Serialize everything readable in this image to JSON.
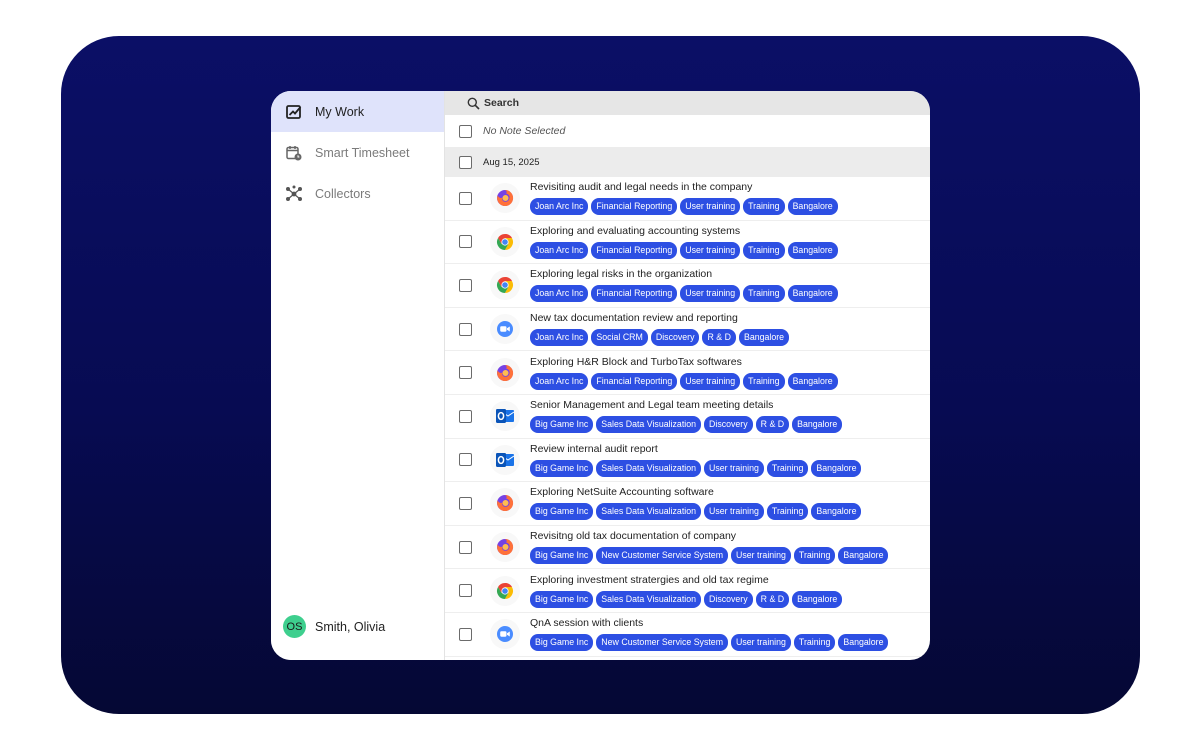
{
  "sidebar": {
    "items": [
      {
        "label": "My Work",
        "icon": "my-work-icon",
        "active": true
      },
      {
        "label": "Smart Timesheet",
        "icon": "timesheet-icon",
        "active": false
      },
      {
        "label": "Collectors",
        "icon": "collectors-icon",
        "active": false
      }
    ],
    "user": {
      "initials": "OS",
      "name": "Smith, Olivia"
    }
  },
  "search": {
    "label": "Search"
  },
  "selection": {
    "label": "No Note Selected"
  },
  "date_group": {
    "label": "Aug 15, 2025"
  },
  "colors": {
    "tag": "#2d4fe3",
    "avatar": "#3ecf8e",
    "backdrop": "#0b0f66",
    "active_nav": "#dfe3fb"
  },
  "notes": [
    {
      "title": "Revisiting audit and legal needs in the company",
      "app": "firefox-icon",
      "tags": [
        "Joan Arc Inc",
        "Financial Reporting",
        "User training",
        "Training",
        "Bangalore"
      ]
    },
    {
      "title": "Exploring and evaluating accounting systems",
      "app": "chrome-icon",
      "tags": [
        "Joan Arc Inc",
        "Financial Reporting",
        "User training",
        "Training",
        "Bangalore"
      ]
    },
    {
      "title": "Exploring legal risks in the organization",
      "app": "chrome-icon",
      "tags": [
        "Joan Arc Inc",
        "Financial Reporting",
        "User training",
        "Training",
        "Bangalore"
      ]
    },
    {
      "title": "New tax documentation review and reporting",
      "app": "zoom-icon",
      "tags": [
        "Joan Arc Inc",
        "Social CRM",
        "Discovery",
        "R & D",
        "Bangalore"
      ]
    },
    {
      "title": "Exploring H&R Block and TurboTax softwares",
      "app": "firefox-icon",
      "tags": [
        "Joan Arc Inc",
        "Financial Reporting",
        "User training",
        "Training",
        "Bangalore"
      ]
    },
    {
      "title": "Senior Management and Legal team meeting details",
      "app": "outlook-icon",
      "tags": [
        "Big Game Inc",
        "Sales Data Visualization",
        "Discovery",
        "R & D",
        "Bangalore"
      ]
    },
    {
      "title": "Review internal audit report",
      "app": "outlook-icon",
      "tags": [
        "Big Game Inc",
        "Sales Data Visualization",
        "User training",
        "Training",
        "Bangalore"
      ]
    },
    {
      "title": "Exploring NetSuite Accounting software",
      "app": "firefox-icon",
      "tags": [
        "Big Game Inc",
        "Sales Data Visualization",
        "User training",
        "Training",
        "Bangalore"
      ]
    },
    {
      "title": "Revisitng old tax documentation of company",
      "app": "firefox-icon",
      "tags": [
        "Big Game Inc",
        "New Customer Service System",
        "User training",
        "Training",
        "Bangalore"
      ]
    },
    {
      "title": "Exploring investment stratergies and old tax regime",
      "app": "chrome-icon",
      "tags": [
        "Big Game Inc",
        "Sales Data Visualization",
        "Discovery",
        "R & D",
        "Bangalore"
      ]
    },
    {
      "title": "QnA session with clients",
      "app": "zoom-icon",
      "tags": [
        "Big Game Inc",
        "New Customer Service System",
        "User training",
        "Training",
        "Bangalore"
      ]
    }
  ]
}
